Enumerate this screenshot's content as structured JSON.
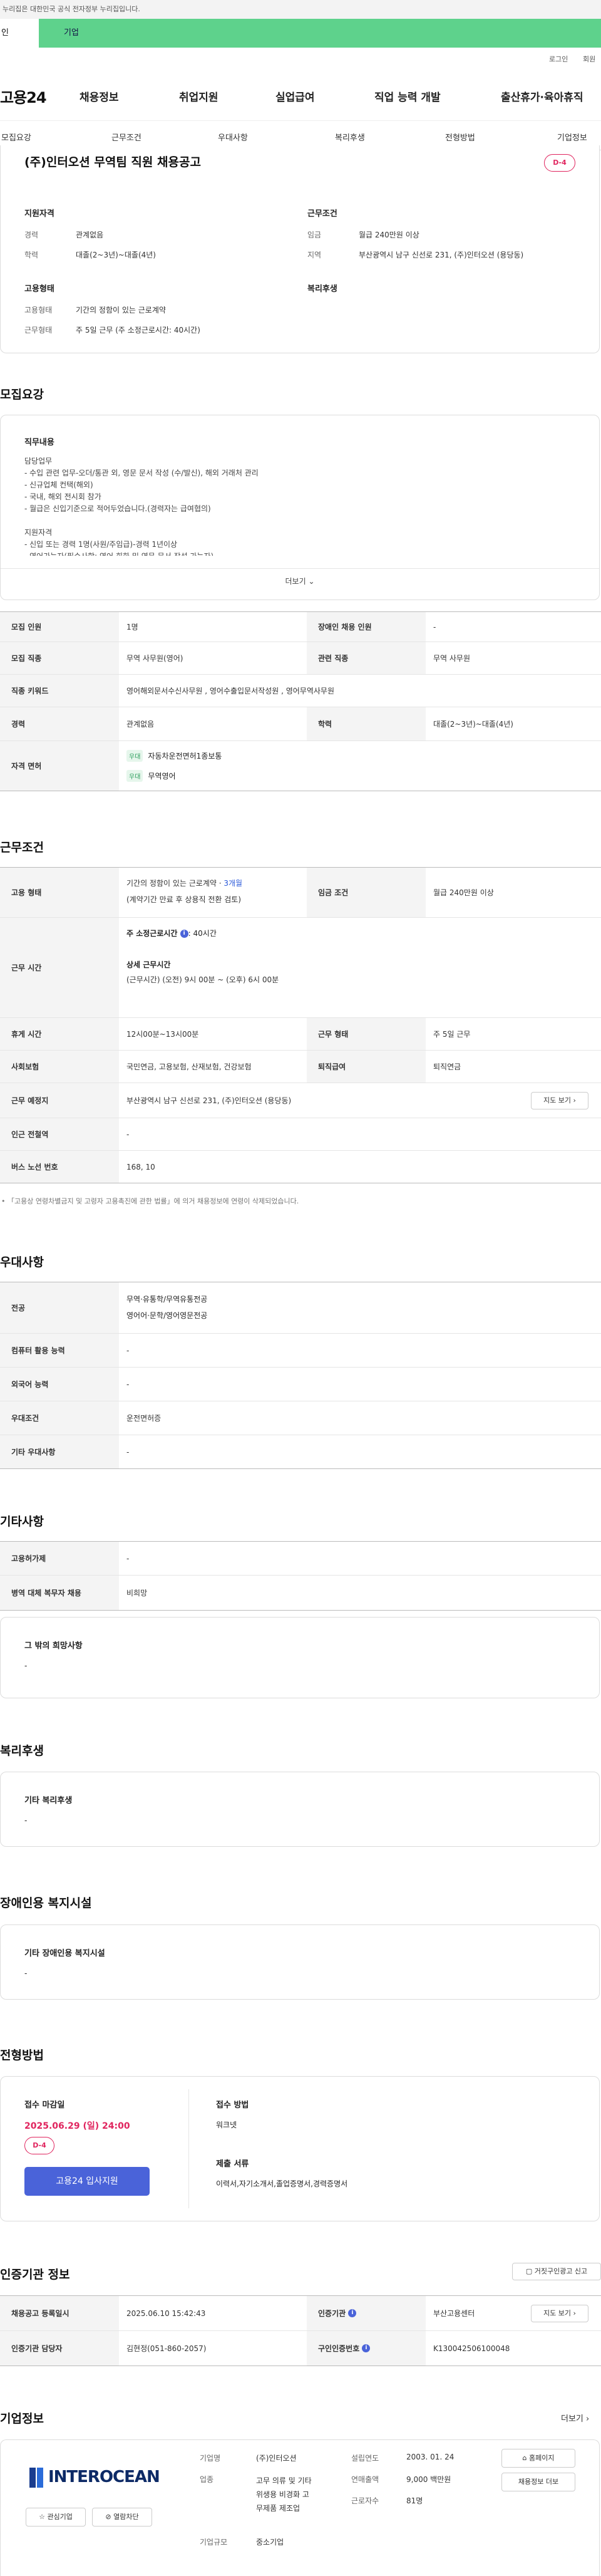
{
  "gov_banner": "누리집은 대한민국 공식 전자정부 누리집입니다.",
  "tabs": {
    "person": "인",
    "corp": "기업"
  },
  "util": {
    "login": "로그인",
    "join": "회원"
  },
  "gnb": {
    "logo": "고용24",
    "items": [
      "채용정보",
      "취업지원",
      "실업급여",
      "직업 능력 개발",
      "출산휴가·육아휴직"
    ]
  },
  "subnav": [
    "모집요강",
    "근무조건",
    "우대사항",
    "복리후생",
    "전형방법",
    "기업정보"
  ],
  "header": {
    "title": "(주)인터오션 무역팀 직원 채용공고",
    "dday": "D-4",
    "qual_title": "지원자격",
    "career_label": "경력",
    "career_value": "관계없음",
    "edu_label": "학력",
    "edu_value": "대졸(2~3년)~대졸(4년)",
    "cond_title": "근무조건",
    "wage_label": "임금",
    "wage_value": "월급 240만원 이상",
    "region_label": "지역",
    "region_value": "부산광역시 남구 신선로 231, (주)인터오션 (용당동)",
    "emp_title": "고용형태",
    "emptype_label": "고용형태",
    "emptype_value": "기간의 정함이 있는 근로계약",
    "worktype_label": "근무형태",
    "worktype_value": "주 5일 근무 (주 소정근로시간: 40시간)",
    "welfare_title": "복리후생"
  },
  "recruit": {
    "section_title": "모집요강",
    "job_title": "직무내용",
    "job_lines": [
      "담당업무",
      "- 수입 관련 업무-오더/통관 외, 영문 문서 작성 (수/발신), 해외 거래처 관리",
      "- 신규업체 컨택(해외)",
      "- 국내, 해외 전시회 참가",
      "- 월급은 신입기준으로 적어두었습니다.(경력자는 급여협의)",
      "",
      "지원자격",
      "- 신입 또는 경력 1명(사원/주임급)-경력 1년이상",
      "- 영어가능자(필수사항: 영어 회화 및 영문 문서 작성 가능자)"
    ],
    "more": "더보기",
    "rows": [
      {
        "l1": "모집 인원",
        "v1": "1명",
        "l2": "장애인 채용 인원",
        "v2": "-"
      },
      {
        "l1": "모집 직종",
        "v1": "무역 사무원(영어)",
        "l2": "관련 직종",
        "v2": "무역 사무원"
      },
      {
        "l1": "직종 키워드",
        "v1": "영어해외문서수신사무원 , 영어수출입문서작성원 , 영어무역사무원"
      },
      {
        "l1": "경력",
        "v1": "관계없음",
        "l2": "학력",
        "v2": "대졸(2~3년)~대졸(4년)"
      }
    ],
    "license_label": "자격 면허",
    "licenses": [
      {
        "tag": "우대",
        "name": "자동차운전면허1종보통"
      },
      {
        "tag": "우대",
        "name": "무역영어"
      }
    ]
  },
  "work": {
    "section_title": "근무조건",
    "emp_label": "고용 형태",
    "emp_value1": "기간의 정함이 있는 근로계약 · ",
    "emp_value1_hl": "3개월",
    "emp_value2": "(계약기간 만료 후 상용직 전환 검토)",
    "wage_label": "임금 조건",
    "wage_value": "월급 240만원 이상",
    "time_label": "근무 시간",
    "hours_title": "주 소정근로시간",
    "hours_value": ": 40시간",
    "detail_title": "상세 근무시간",
    "detail_value": "(근무시간) (오전) 9시 00분 ~ (오후) 6시 00분",
    "rest_label": "휴게 시간",
    "rest_value": "12시00분~13시00분",
    "form_label": "근무 형태",
    "form_value": "주 5일 근무",
    "ins_label": "사회보험",
    "ins_value": "국민연금, 고용보험, 산재보험, 건강보험",
    "retire_label": "퇴직급여",
    "retire_value": "퇴직연금",
    "place_label": "근무 예정지",
    "place_value": "부산광역시 남구 신선로 231, (주)인터오션 (용당동)",
    "map_btn": "지도 보기",
    "subway_label": "인근 전철역",
    "subway_value": "-",
    "bus_label": "버스 노선 번호",
    "bus_value": "168, 10",
    "notice": "「고용상 연령차별금지 및 고령자 고용촉진에 관한 법률」에 의거 채용정보에 연령이 삭제되었습니다."
  },
  "pref": {
    "section_title": "우대사항",
    "rows": [
      {
        "l": "전공",
        "v": "무역·유통학/무역유통전공",
        "v2": "영어어·문학/영어영문전공"
      },
      {
        "l": "컴퓨터 활용 능력",
        "v": "-"
      },
      {
        "l": "외국어 능력",
        "v": "-"
      },
      {
        "l": "우대조건",
        "v": "운전면허증"
      },
      {
        "l": "기타 우대사항",
        "v": "-"
      }
    ]
  },
  "etc": {
    "section_title": "기타사항",
    "rows": [
      {
        "l": "고용허가제",
        "v": "-"
      },
      {
        "l": "병역 대체 복무자 채용",
        "v": "비희망"
      }
    ],
    "box_title": "그 밖의 희망사항",
    "box_value": "-"
  },
  "welfare": {
    "section_title": "복리후생",
    "box_title": "기타 복리후생",
    "box_value": "-"
  },
  "disabled": {
    "section_title": "장애인용 복지시설",
    "box_title": "기타 장애인용 복지시설",
    "box_value": "-"
  },
  "selection": {
    "section_title": "전형방법",
    "deadline_title": "접수 마감일",
    "deadline": "2025.06.29 (일) 24:00",
    "dday": "D-4",
    "apply_btn": "고용24 입사지원",
    "method_title": "접수 방법",
    "method_value": "워크넷",
    "docs_title": "제출 서류",
    "docs_value": "이력서,자기소개서,졸업증명서,경력증명서"
  },
  "cert": {
    "section_title": "인증기관 정보",
    "report_btn": "거짓구인광고 신고",
    "reg_label": "채용공고 등록일시",
    "reg_value": "2025.06.10 15:42:43",
    "org_label": "인증기관",
    "org_value": "부산고용센터",
    "view_btn": "지도 보기",
    "mgr_label": "인증기관 담당자",
    "mgr_value": "김현정(051-860-2057)",
    "num_label": "구인인증번호",
    "num_value": "K130042506100048"
  },
  "company": {
    "section_title": "기업정보",
    "more": "더보기",
    "logo_text": "INTEROCEAN",
    "fav_btn": "관심기업",
    "block_btn": "열람차단",
    "name_label": "기업명",
    "name_value": "(주)인터오션",
    "industry_label": "업종",
    "industry_value": [
      "고무 의류 및 기타",
      "위생용 비경화 고",
      "무제품 제조업"
    ],
    "size_label": "기업규모",
    "size_value": "중소기업",
    "founded_label": "설립연도",
    "founded_value": "2003. 01. 24",
    "sales_label": "연매출액",
    "sales_value": "9,000 백만원",
    "staff_label": "근로자수",
    "staff_value": "81명",
    "home_btn": "홈페이지",
    "jobs_btn": "채용정보 더보"
  },
  "colors": {
    "accent_green": "#5ed28c",
    "dday_red": "#e0245e",
    "primary_blue": "#4a63d9"
  }
}
